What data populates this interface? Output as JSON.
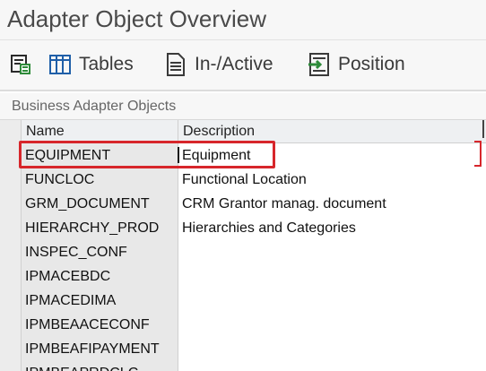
{
  "window": {
    "title": "Adapter Object Overview"
  },
  "toolbar": {
    "items": [
      {
        "icon": "filter-settings-icon",
        "label": ""
      },
      {
        "icon": "table-icon",
        "label": "Tables"
      },
      {
        "icon": "document-icon",
        "label": "In-/Active"
      },
      {
        "icon": "position-icon",
        "label": "Position"
      }
    ]
  },
  "section": {
    "title": "Business Adapter Objects"
  },
  "grid": {
    "columns": [
      "Name",
      "Description"
    ],
    "rows": [
      {
        "name": "EQUIPMENT",
        "description": "Equipment"
      },
      {
        "name": "FUNCLOC",
        "description": "Functional Location"
      },
      {
        "name": "GRM_DOCUMENT",
        "description": "CRM Grantor  manag. document"
      },
      {
        "name": "HIERARCHY_PROD",
        "description": "Hierarchies and Categories"
      },
      {
        "name": "INSPEC_CONF",
        "description": ""
      },
      {
        "name": "IPMACEBDC",
        "description": ""
      },
      {
        "name": "IPMACEDIMA",
        "description": ""
      },
      {
        "name": "IPMBEAACECONF",
        "description": ""
      },
      {
        "name": "IPMBEAFIPAYMENT",
        "description": ""
      },
      {
        "name": "IPMBEAPRDCLC",
        "description": ""
      }
    ],
    "selected_row": 0
  },
  "colors": {
    "highlight": "#d7262b"
  }
}
